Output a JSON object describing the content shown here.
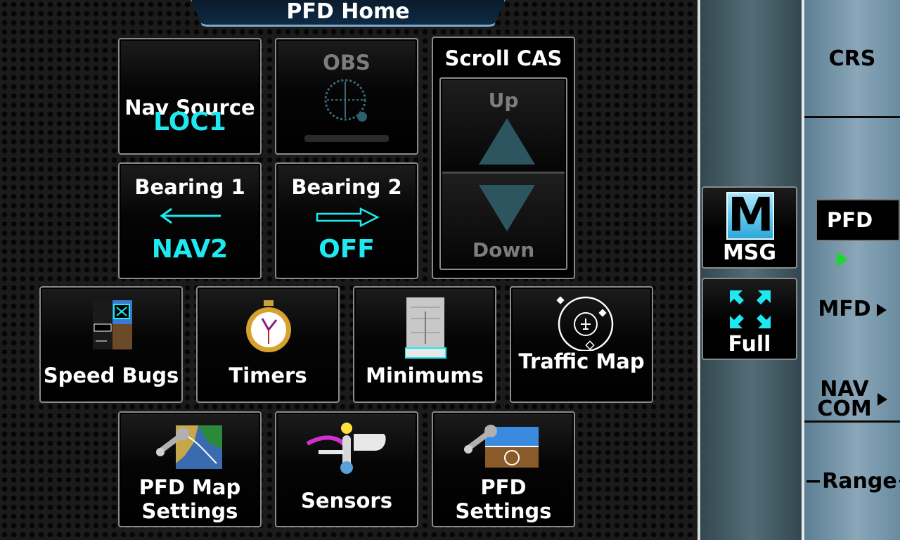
{
  "title": "PFD Home",
  "buttons": {
    "nav_source": {
      "label": "Nav Source",
      "value": "LOC1"
    },
    "obs": {
      "label": "OBS"
    },
    "scroll_cas": {
      "label": "Scroll CAS",
      "up": "Up",
      "down": "Down"
    },
    "bearing1": {
      "label": "Bearing 1",
      "value": "NAV2"
    },
    "bearing2": {
      "label": "Bearing 2",
      "value": "OFF"
    },
    "speed_bugs": {
      "label": "Speed Bugs"
    },
    "timers": {
      "label": "Timers"
    },
    "minimums": {
      "label": "Minimums"
    },
    "traffic_map": {
      "label": "Traffic Map"
    },
    "pfd_map_settings": {
      "line1": "PFD Map",
      "line2": "Settings"
    },
    "sensors": {
      "label": "Sensors"
    },
    "pfd_settings": {
      "line1": "PFD",
      "line2": "Settings"
    }
  },
  "side_buttons": {
    "msg": {
      "icon_letter": "M",
      "label": "MSG"
    },
    "full": {
      "label": "Full"
    }
  },
  "softkeys": {
    "crs": "CRS",
    "pfd": "PFD",
    "mfd": "MFD",
    "nav": "NAV",
    "com": "COM",
    "range": "−Range+"
  },
  "colors": {
    "accent_cyan": "#1ee9f0",
    "active_green": "#1bd82a",
    "title_bg": "#0e2a44"
  }
}
